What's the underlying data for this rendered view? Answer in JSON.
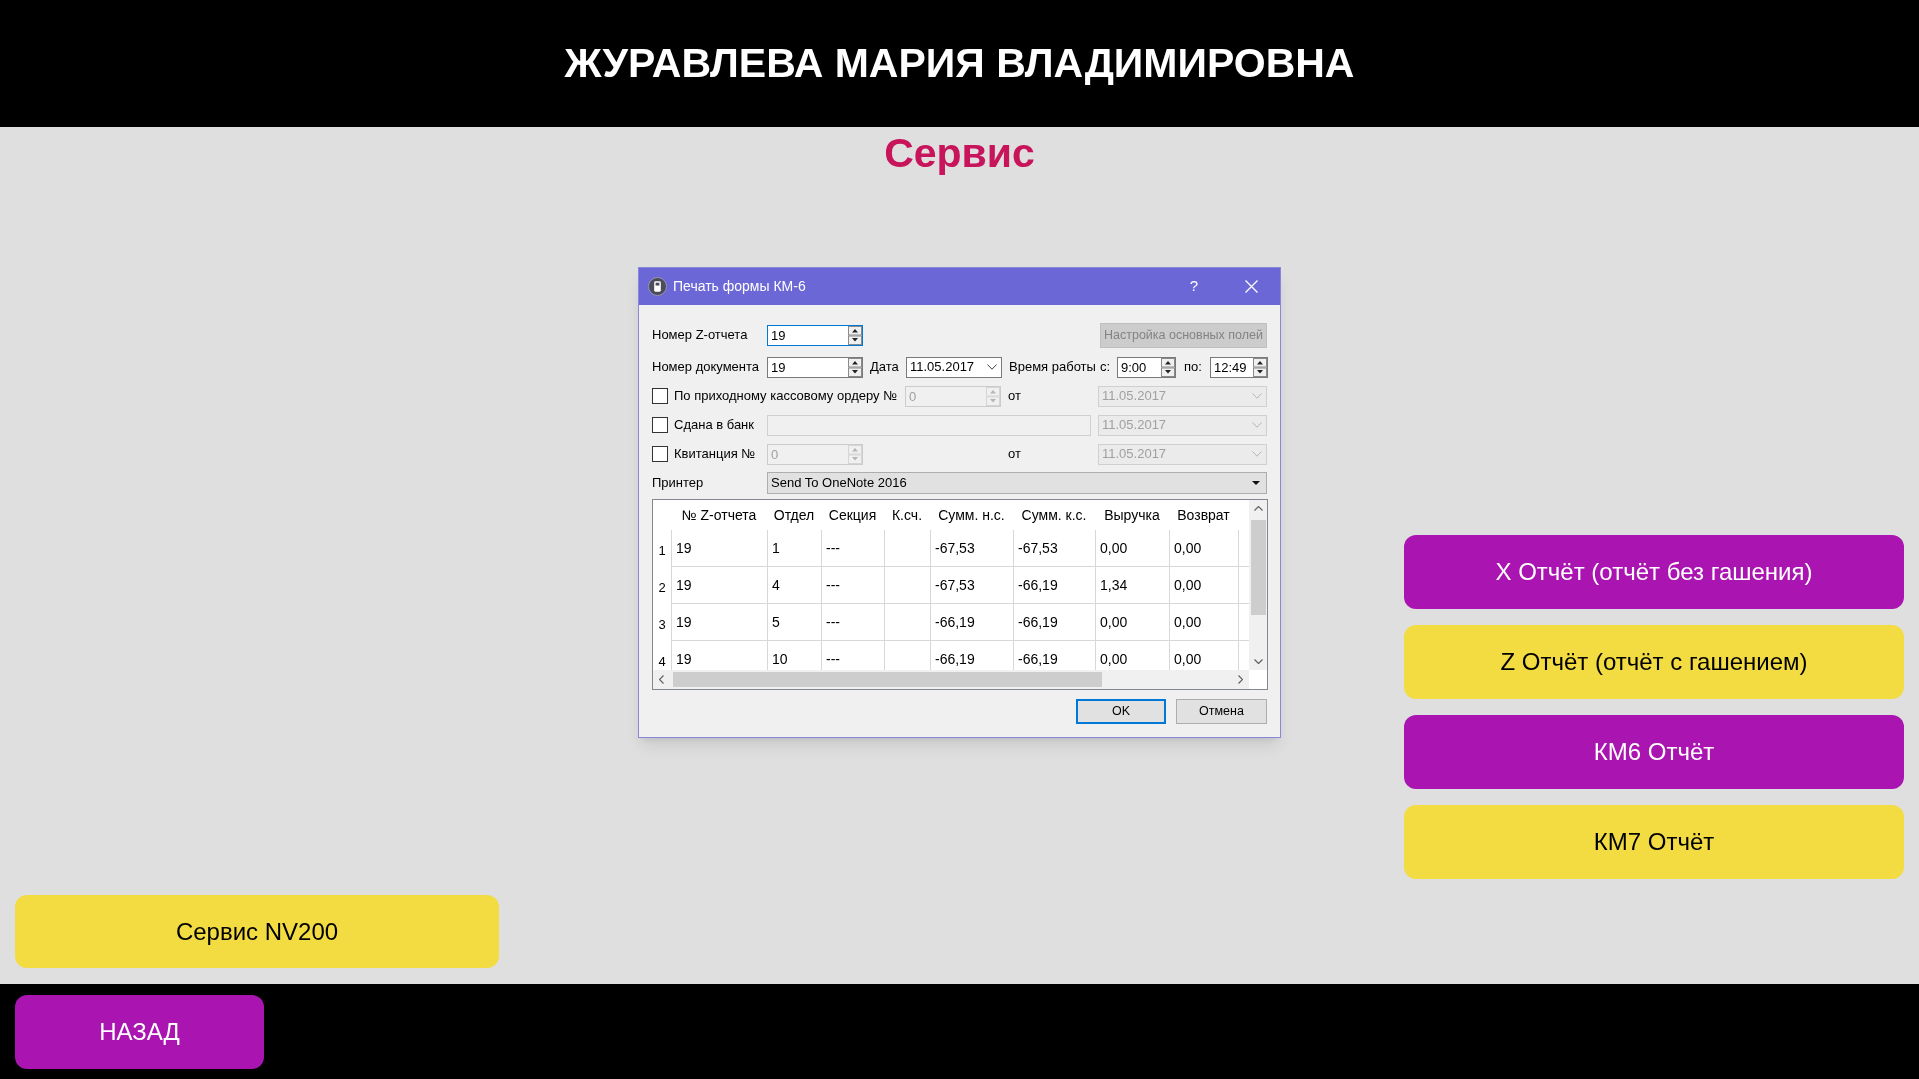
{
  "header": {
    "user_name": "ЖУРАВЛЕВА МАРИЯ ВЛАДИМИРОВНА"
  },
  "page_title": "Сервис",
  "dialog": {
    "title": "Печать формы КМ-6",
    "help": "?",
    "z_report_number": {
      "label": "Номер Z-отчета",
      "value": "19",
      "focused": true
    },
    "settings_button": {
      "label": "Настройка основных полей",
      "disabled": true
    },
    "document_number": {
      "label": "Номер документа",
      "value": "19",
      "focused": false
    },
    "date": {
      "label": "Дата",
      "value": "11.05.2017"
    },
    "work_time": {
      "label": "Время работы",
      "from_label": "с:",
      "from": "9:00",
      "to_label": "по:",
      "to": "12:49"
    },
    "options": [
      {
        "kind": "spin",
        "label": "По приходному кассовому ордеру №",
        "checked": false,
        "value": "0",
        "date_label": "от",
        "date": "11.05.2017"
      },
      {
        "kind": "text",
        "label": "Сдана в банк",
        "checked": false,
        "date": "11.05.2017"
      },
      {
        "kind": "spin",
        "label": "Квитанция №",
        "checked": false,
        "value": "0",
        "date_label": "от",
        "date": "11.05.2017"
      }
    ],
    "printer": {
      "label": "Принтер",
      "value": "Send To OneNote 2016"
    },
    "table": {
      "columns": [
        "№ Z-отчета",
        "Отдел",
        "Секция",
        "К.сч.",
        "Сумм. н.с.",
        "Сумм. к.с.",
        "Выручка",
        "Возврат"
      ],
      "rows": [
        {
          "number": "1",
          "z_report": "19",
          "department": "1",
          "section": "---",
          "sum_start": "-67,53",
          "sum_end": "-67,53",
          "revenue": "0,00",
          "refund": "0,00"
        },
        {
          "number": "2",
          "z_report": "19",
          "department": "4",
          "section": "---",
          "sum_start": "-67,53",
          "sum_end": "-66,19",
          "revenue": "1,34",
          "refund": "0,00"
        },
        {
          "number": "3",
          "z_report": "19",
          "department": "5",
          "section": "---",
          "sum_start": "-66,19",
          "sum_end": "-66,19",
          "revenue": "0,00",
          "refund": "0,00"
        },
        {
          "number": "4",
          "z_report": "19",
          "department": "10",
          "section": "---",
          "sum_start": "-66,19",
          "sum_end": "-66,19",
          "revenue": "0,00",
          "refund": "0,00"
        }
      ]
    },
    "buttons": [
      {
        "label": "OK",
        "default": true
      },
      {
        "label": "Отмена",
        "default": false
      }
    ]
  },
  "report_buttons": [
    {
      "label": "X Отчёт (отчёт без гашения)",
      "color": "#aa14b0"
    },
    {
      "label": "Z Отчёт (отчёт с гашением)",
      "color": "#f2dc42"
    },
    {
      "label": "КМ6 Отчёт",
      "color": "#aa14b0"
    },
    {
      "label": "КМ7 Отчёт",
      "color": "#f2dc42"
    }
  ],
  "service_button": {
    "label": "Сервис NV200"
  },
  "back_button": {
    "label": "НАЗАД"
  }
}
